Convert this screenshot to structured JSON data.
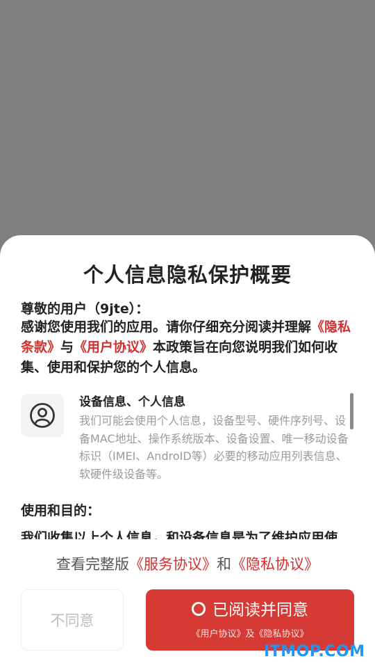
{
  "dialog": {
    "title": "个人信息隐私保护概要",
    "greeting": "尊敬的用户（9jte）：",
    "intro": {
      "part1": "感谢您使用我们的应用。请你仔细充分阅读并理解",
      "link1": "《隐私条款》",
      "part2": "与",
      "link2": "《用户协议》",
      "part3": "本政策旨在向您说明我们如何收集、使用和保护您的个人信息。"
    },
    "info_item": {
      "icon": "user-circle-icon",
      "title": "设备信息、个人信息",
      "description": "我们可能会使用个人信息，设备型号、硬件序列号、设备MAC地址、操作系统版本、设备设置、唯一移动设备标识（IMEI、AndroID等）必要的移动应用列表信息、软硬件级设备等。"
    },
    "section_title": "使用和目的：",
    "clipped_text": "我们收集以上个人信息，和设备信息是为了维护应用使",
    "full_version": {
      "prefix": "查看完整版",
      "service_link": "《服务协议》",
      "and": "和",
      "privacy_link": "《隐私协议》"
    },
    "buttons": {
      "disagree": "不同意",
      "agree": "已阅读并同意",
      "agree_sub": "《用户协议》及《隐私协议》"
    }
  },
  "watermark": "ITMOP.COM",
  "colors": {
    "accent": "#d63a35",
    "overlay": "#7f7f7f"
  }
}
